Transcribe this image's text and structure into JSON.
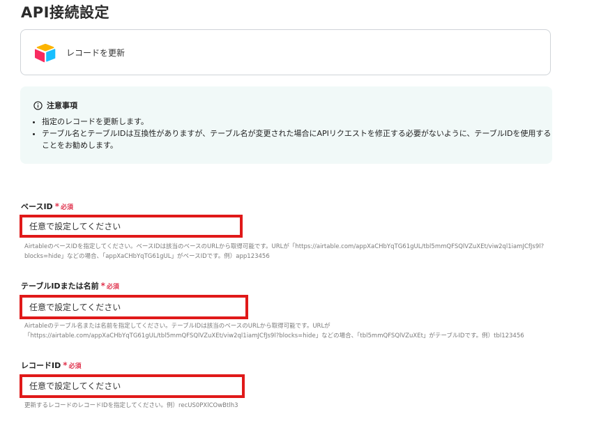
{
  "page": {
    "title": "API接続設定"
  },
  "action": {
    "label": "レコードを更新",
    "icon": "airtable-logo"
  },
  "notice": {
    "title": "注意事項",
    "icon": "info-icon",
    "items": [
      "指定のレコードを更新します。",
      "テーブル名とテーブルIDは互換性がありますが、テーブル名が変更された場合にAPIリクエストを修正する必要がないように、テーブルIDを使用することをお勧めします。"
    ]
  },
  "fields": [
    {
      "label": "ベースID",
      "required_mark": "*",
      "required_text": "必須",
      "placeholder": "任意で設定してください",
      "value": "",
      "help": "AirtableのベースIDを指定してください。ベースIDは該当のベースのURLから取得可能です。URLが「https://airtable.com/appXaCHbYqTG61gUL/tbl5mmQFSQlVZuXEt/viw2ql1iamJCfJs9l?blocks=hide」などの場合、「appXaCHbYqTG61gUL」がベースIDです。例）app123456"
    },
    {
      "label": "テーブルIDまたは名前",
      "required_mark": "*",
      "required_text": "必須",
      "placeholder": "任意で設定してください",
      "value": "",
      "help": "Airtableのテーブル名または名前を指定してください。テーブルIDは該当のベースのURLから取得可能です。URLが「https://airtable.com/appXaCHbYqTG61gUL/tbl5mmQFSQlVZuXEt/viw2ql1iamJCfJs9l?blocks=hide」などの場合、「tbl5mmQFSQlVZuXEt」がテーブルIDです。例）tbl123456"
    },
    {
      "label": "レコードID",
      "required_mark": "*",
      "required_text": "必須",
      "placeholder": "任意で設定してください",
      "value": "",
      "help": "更新するレコードのレコードIDを指定してください。例）recUS0PXlCOwBtlh3"
    }
  ],
  "colors": {
    "highlight_border": "#e01919",
    "required": "#e0334d",
    "notice_bg": "#f1f9f8"
  }
}
